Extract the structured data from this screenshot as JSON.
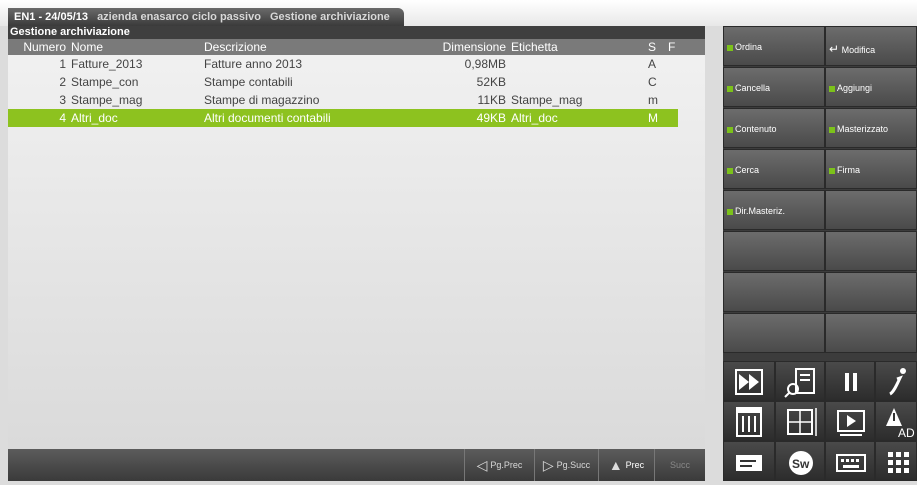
{
  "window": {
    "title": "EN1 - 24/05/13",
    "subtitle_company": "azienda enasarco ciclo passivo",
    "subtitle_section": "Gestione archiviazione"
  },
  "panel": {
    "title": "Gestione archiviazione",
    "columns": [
      "Numero",
      "Nome",
      "Descrizione",
      "Dimensione",
      "Etichetta",
      "S",
      "F"
    ],
    "rows": [
      {
        "num": "1",
        "nome": "Fatture_2013",
        "desc": "Fatture anno 2013",
        "dim": "0,98MB",
        "etich": "",
        "s": "A",
        "selected": false
      },
      {
        "num": "2",
        "nome": "Stampe_con",
        "desc": "Stampe contabili",
        "dim": "52KB",
        "etich": "",
        "s": "C",
        "selected": false
      },
      {
        "num": "3",
        "nome": "Stampe_mag",
        "desc": "Stampe di magazzino",
        "dim": "11KB",
        "etich": "Stampe_mag",
        "s": "m",
        "selected": false
      },
      {
        "num": "4",
        "nome": "Altri_doc",
        "desc": "Altri documenti contabili",
        "dim": "49KB",
        "etich": "Altri_doc",
        "s": "M",
        "selected": true
      }
    ]
  },
  "bottom": {
    "pg_prec": "Pg.Prec",
    "pg_succ": "Pg.Succ",
    "prec": "Prec",
    "succ": "Succ"
  },
  "functions": {
    "ordina": "Ordina",
    "modifica": "Modifica",
    "cancella": "Cancella",
    "aggiungi": "Aggiungi",
    "contenuto": "Contenuto",
    "masterizzato": "Masterizzato",
    "cerca": "Cerca",
    "firma": "Firma",
    "dir_masteriz": "Dir.Masteriz.",
    "accent_color": "#7cc21a"
  },
  "icons": [
    "fast-forward-icon",
    "search-document-icon",
    "pause-icon",
    "info-icon",
    "calendar-icon",
    "grid-edit-icon",
    "video-icon",
    "warning-ad-icon",
    "message-icon",
    "sw-icon",
    "keyboard-icon",
    "apps-grid-icon"
  ]
}
